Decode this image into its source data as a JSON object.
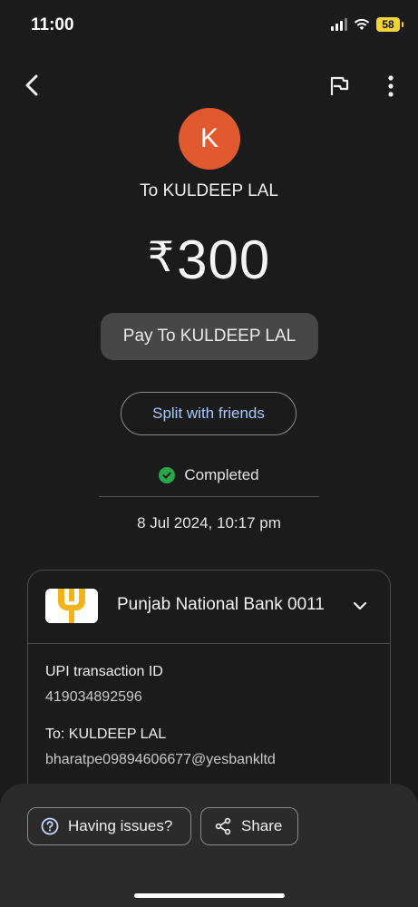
{
  "status_bar": {
    "time": "11:00",
    "battery": "58"
  },
  "payee": {
    "avatar_letter": "K",
    "recipient_line": "To KULDEEP LAL"
  },
  "payment": {
    "currency_symbol": "₹",
    "amount": "300"
  },
  "pay_chip_label": "Pay To KULDEEP LAL",
  "split_label": "Split with friends",
  "status": {
    "text": "Completed",
    "date": "8 Jul 2024, 10:17 pm"
  },
  "details": {
    "bank_name": "Punjab National Bank 0011",
    "upi_label": "UPI transaction ID",
    "upi_value": "419034892596",
    "to_label": "To: KULDEEP LAL",
    "to_value": "bharatpe09894606677@yesbankltd"
  },
  "actions": {
    "issues_label": "Having issues?",
    "share_label": "Share"
  },
  "colors": {
    "background": "#1b1b1b",
    "avatar": "#e15a2f",
    "completed_check": "#2aa64a",
    "link_blue": "#a9c7ff",
    "battery": "#f0d43a"
  }
}
